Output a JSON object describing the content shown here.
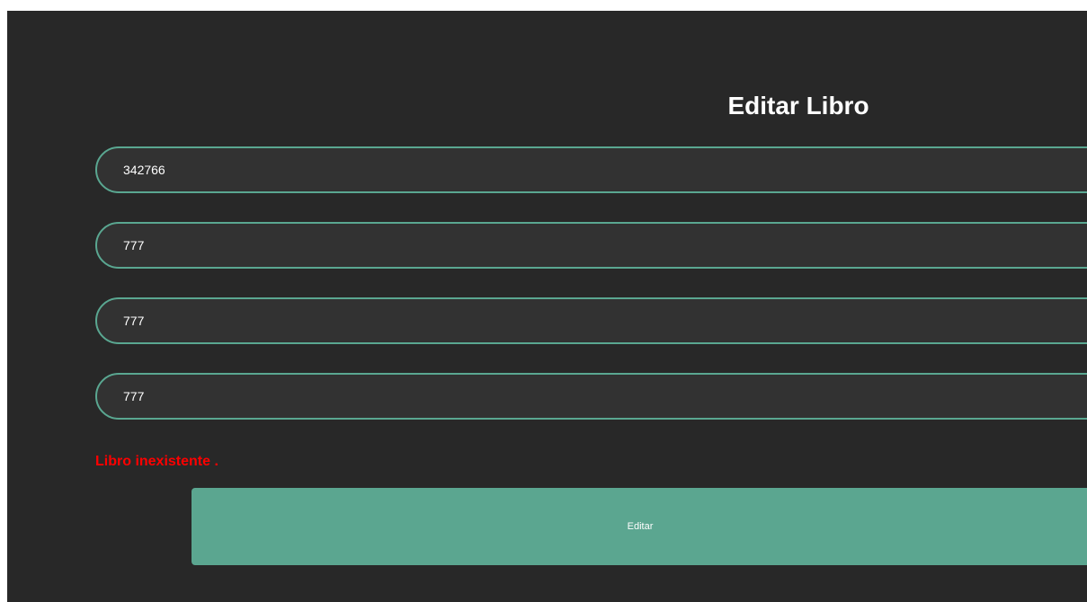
{
  "form": {
    "title": "Editar Libro",
    "fields": [
      {
        "value": "342766"
      },
      {
        "value": "777"
      },
      {
        "value": "777"
      },
      {
        "value": "777"
      }
    ],
    "error_message": "Libro inexistente .",
    "submit_label": "Editar"
  },
  "colors": {
    "background": "#282828",
    "field_border": "#5aa791",
    "button": "#5ba690",
    "error": "#ff0000"
  }
}
